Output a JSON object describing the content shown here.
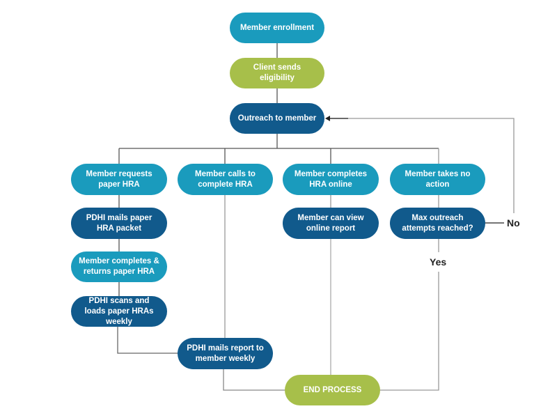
{
  "diagram": {
    "colors": {
      "start": "#1a9bbd",
      "action": "#115a8c",
      "milestone": "#a7bf4a",
      "connector": "#8a8a8a"
    },
    "nodes": {
      "enroll": "Member enrollment",
      "eligibility": "Client sends eligibility",
      "outreach": "Outreach to member",
      "requests_paper": "Member requests paper HRA",
      "calls": "Member calls to complete HRA",
      "online": "Member completes HRA online",
      "no_action": "Member takes no action",
      "mails_packet": "PDHI mails paper HRA packet",
      "view_report": "Member can view online report",
      "max_attempts": "Max outreach attempts reached?",
      "returns_paper": "Member completes & returns paper HRA",
      "scans": "PDHI scans and loads paper HRAs weekly",
      "mails_report": "PDHI mails report to member weekly",
      "end": "END PROCESS"
    },
    "labels": {
      "no": "No",
      "yes": "Yes"
    },
    "edges": [
      [
        "enroll",
        "eligibility"
      ],
      [
        "eligibility",
        "outreach"
      ],
      [
        "outreach",
        "requests_paper"
      ],
      [
        "outreach",
        "calls"
      ],
      [
        "outreach",
        "online"
      ],
      [
        "outreach",
        "no_action"
      ],
      [
        "requests_paper",
        "mails_packet"
      ],
      [
        "mails_packet",
        "returns_paper"
      ],
      [
        "returns_paper",
        "scans"
      ],
      [
        "scans",
        "mails_report"
      ],
      [
        "calls",
        "mails_report"
      ],
      [
        "mails_report",
        "end"
      ],
      [
        "online",
        "view_report"
      ],
      [
        "view_report",
        "end"
      ],
      [
        "no_action",
        "max_attempts"
      ],
      [
        "max_attempts",
        "outreach",
        "No"
      ],
      [
        "max_attempts",
        "end",
        "Yes"
      ]
    ]
  }
}
